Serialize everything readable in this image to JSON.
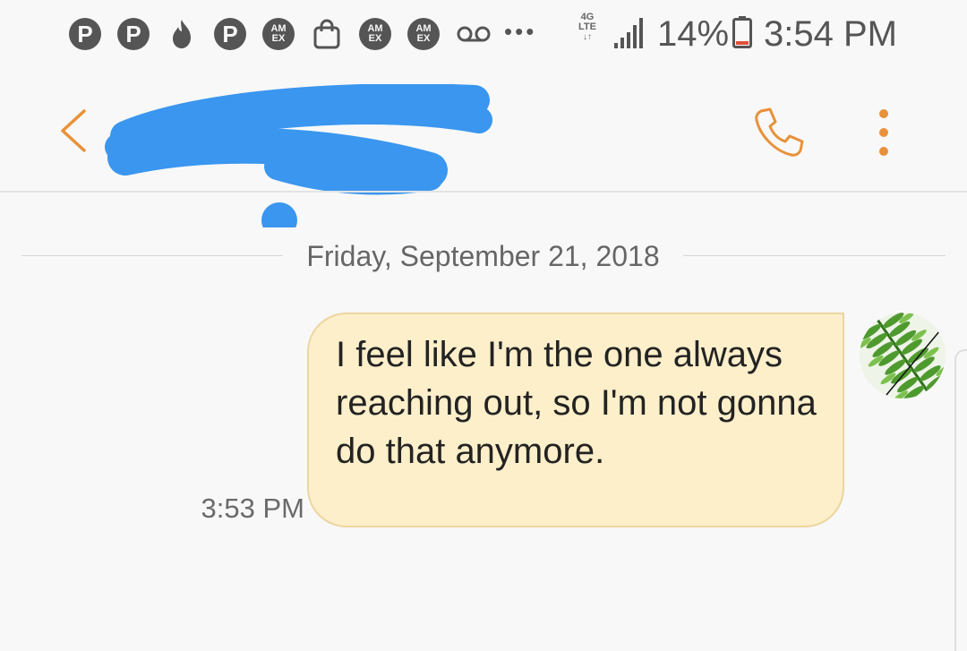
{
  "status_bar": {
    "notification_icons": [
      "pinterest-icon",
      "pinterest-icon",
      "tinder-icon",
      "pinterest-icon",
      "amex-icon",
      "shopping-bag-icon",
      "amex-icon",
      "amex-icon",
      "voicemail-icon"
    ],
    "amex_label_top": "AM",
    "amex_label_bottom": "EX",
    "more_label": "•••",
    "network_label_top": "4G",
    "network_label_bottom": "LTE",
    "battery_percent": "14%",
    "battery_level": 0.14,
    "time": "3:54 PM"
  },
  "header": {
    "contact_name": "",
    "accent_color": "#e8913a",
    "redaction_color": "#3a96ef"
  },
  "conversation": {
    "date_separator": "Friday, September 21, 2018",
    "messages": [
      {
        "direction": "outgoing",
        "text": "I feel like I'm the one always reaching out, so I'm not gonna do that anymore.",
        "time": "3:53 PM",
        "bubble_color": "#fdefca"
      }
    ]
  }
}
